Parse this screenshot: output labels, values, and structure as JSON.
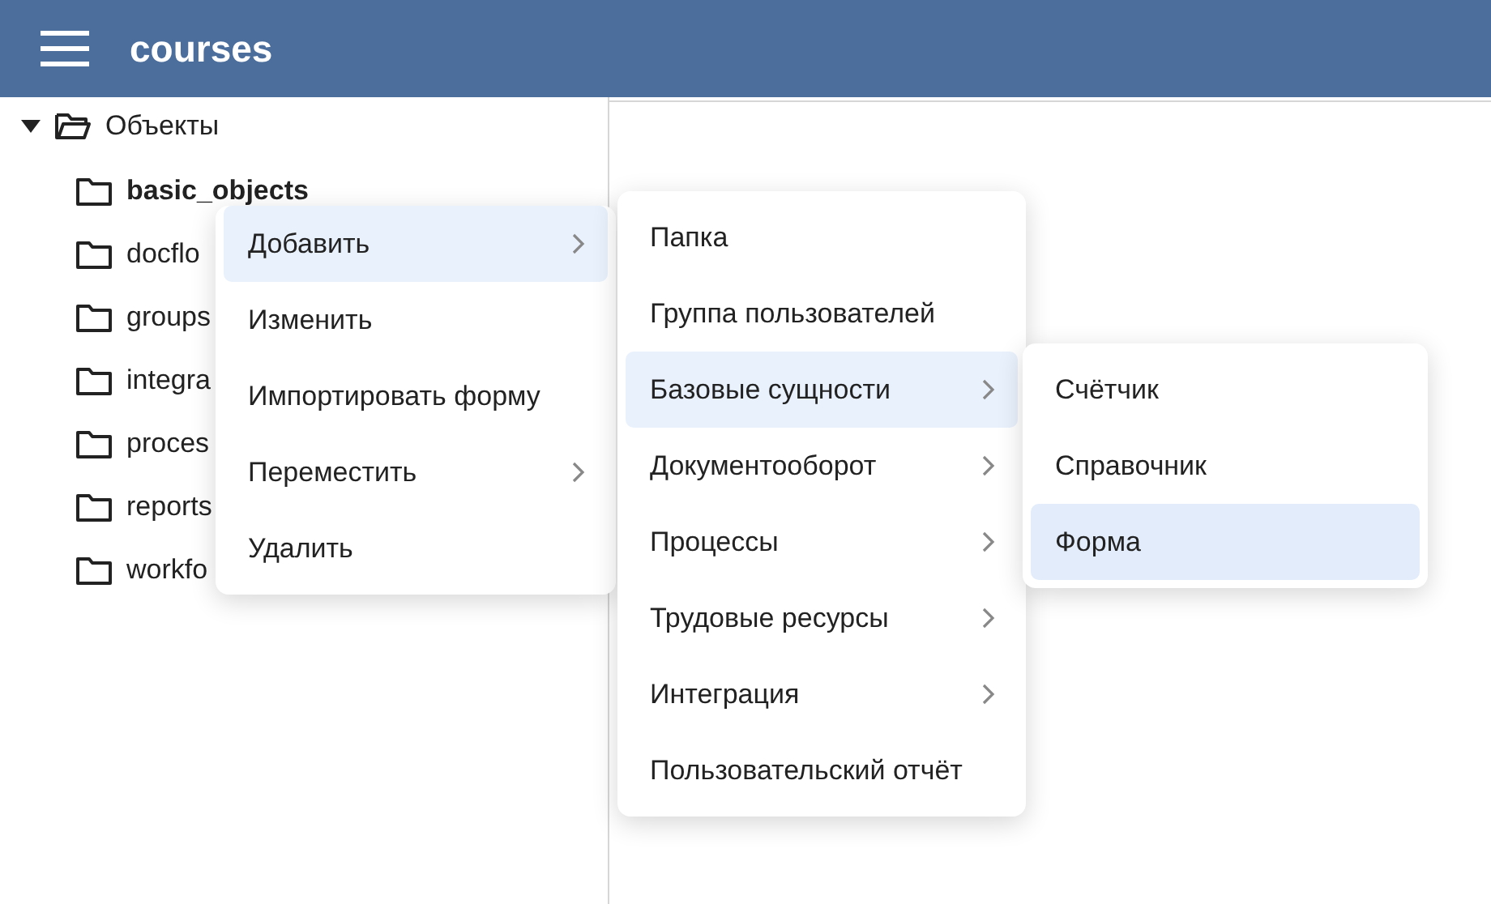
{
  "header": {
    "title": "courses"
  },
  "tree": {
    "label": "Объекты",
    "expanded": true,
    "children": [
      {
        "label": "basic_objects",
        "selected": true
      },
      {
        "label": "docflo",
        "selected": false
      },
      {
        "label": "groups",
        "selected": false
      },
      {
        "label": "integra",
        "selected": false
      },
      {
        "label": "proces",
        "selected": false
      },
      {
        "label": "reports",
        "selected": false
      },
      {
        "label": "workfo",
        "selected": false
      }
    ]
  },
  "menus": [
    {
      "items": [
        {
          "label": "Добавить",
          "submenu": true,
          "selected": true
        },
        {
          "label": "Изменить",
          "submenu": false,
          "selected": false
        },
        {
          "label": "Импортировать форму",
          "submenu": false,
          "selected": false
        },
        {
          "label": "Переместить",
          "submenu": true,
          "selected": false
        },
        {
          "label": "Удалить",
          "submenu": false,
          "selected": false
        }
      ]
    },
    {
      "items": [
        {
          "label": "Папка",
          "submenu": false,
          "selected": false
        },
        {
          "label": "Группа пользователей",
          "submenu": false,
          "selected": false
        },
        {
          "label": "Базовые сущности",
          "submenu": true,
          "selected": true
        },
        {
          "label": "Документооборот",
          "submenu": true,
          "selected": false
        },
        {
          "label": "Процессы",
          "submenu": true,
          "selected": false
        },
        {
          "label": "Трудовые ресурсы",
          "submenu": true,
          "selected": false
        },
        {
          "label": "Интеграция",
          "submenu": true,
          "selected": false
        },
        {
          "label": "Пользовательский отчёт",
          "submenu": false,
          "selected": false
        }
      ]
    },
    {
      "items": [
        {
          "label": "Счётчик",
          "submenu": false,
          "selected": false
        },
        {
          "label": "Справочник",
          "submenu": false,
          "selected": false
        },
        {
          "label": "Форма",
          "submenu": false,
          "selected": true
        }
      ]
    }
  ]
}
